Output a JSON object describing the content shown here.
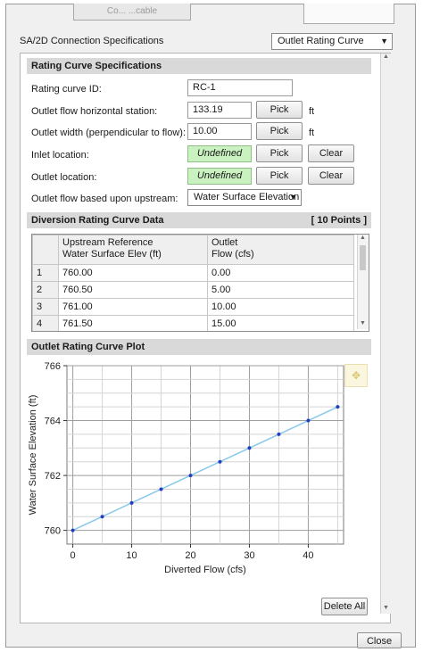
{
  "top_tab_text": "Co... ...cable",
  "header": {
    "title": "SA/2D Connection Specifications",
    "mode_select": "Outlet Rating Curve"
  },
  "rating_section": {
    "title": "Rating Curve Specifications",
    "fields": {
      "id_label": "Rating curve ID:",
      "id_value": "RC-1",
      "station_label": "Outlet flow horizontal station:",
      "station_value": "133.19",
      "station_unit": "ft",
      "width_label": "Outlet width (perpendicular to flow):",
      "width_value": "10.00",
      "width_unit": "ft",
      "inlet_label": "Inlet location:",
      "inlet_value": "Undefined",
      "outlet_label": "Outlet location:",
      "outlet_value": "Undefined",
      "upstream_label": "Outlet flow based upon upstream:",
      "upstream_value": "Water Surface Elevation"
    },
    "pick_label": "Pick",
    "clear_label": "Clear"
  },
  "diversion_section": {
    "title": "Diversion Rating Curve Data",
    "points_badge": "[ 10 Points ]",
    "col1": "Upstream Reference Water Surface Elev (ft)",
    "col1_line1": "Upstream Reference",
    "col1_line2": "Water Surface Elev (ft)",
    "col2_line1": "Outlet",
    "col2_line2": "Flow (cfs)",
    "rows": [
      {
        "n": "1",
        "elev": "760.00",
        "flow": "0.00"
      },
      {
        "n": "2",
        "elev": "760.50",
        "flow": "5.00"
      },
      {
        "n": "3",
        "elev": "761.00",
        "flow": "10.00"
      },
      {
        "n": "4",
        "elev": "761.50",
        "flow": "15.00"
      }
    ]
  },
  "plot_section": {
    "title": "Outlet Rating Curve Plot",
    "delete_all_label": "Delete All"
  },
  "chart_data": {
    "type": "line",
    "title": "",
    "xlabel": "Diverted Flow (cfs)",
    "ylabel": "Water Surface Elevation (ft)",
    "xlim": [
      -1,
      46
    ],
    "ylim": [
      759.5,
      766
    ],
    "xticks": [
      0,
      10,
      20,
      30,
      40
    ],
    "yticks": [
      760,
      762,
      764,
      766
    ],
    "grid": true,
    "series": [
      {
        "x": [
          0,
          5,
          10,
          15,
          20,
          25,
          30,
          35,
          40,
          45
        ],
        "y": [
          760,
          760.5,
          761,
          761.5,
          762,
          762.5,
          763,
          763.5,
          764,
          764.5
        ],
        "line_color": "#87c9ea",
        "marker_color": "#1f3fbf"
      }
    ]
  },
  "footer": {
    "close_label": "Close"
  }
}
